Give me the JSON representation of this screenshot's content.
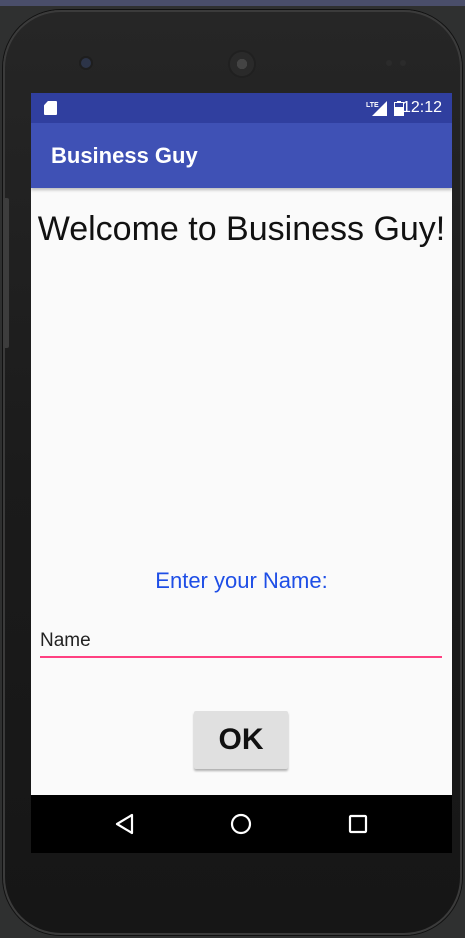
{
  "status_bar": {
    "time": "12:12",
    "sd_card_icon": "sd-card-icon",
    "signal_icon": "lte-signal-icon",
    "battery_icon": "battery-icon"
  },
  "app_bar": {
    "title": "Business Guy"
  },
  "main": {
    "welcome_text": "Welcome to Business Guy!",
    "prompt_label": "Enter your Name:",
    "name_input": {
      "value": "Name",
      "placeholder": "Name"
    },
    "ok_button": "OK"
  },
  "nav_bar": {
    "back": "back-icon",
    "home": "home-icon",
    "recents": "recents-icon"
  },
  "colors": {
    "status_bar": "#303f9f",
    "app_bar": "#3f51b5",
    "accent": "#ff4081",
    "prompt_text": "#1e4ee6"
  }
}
